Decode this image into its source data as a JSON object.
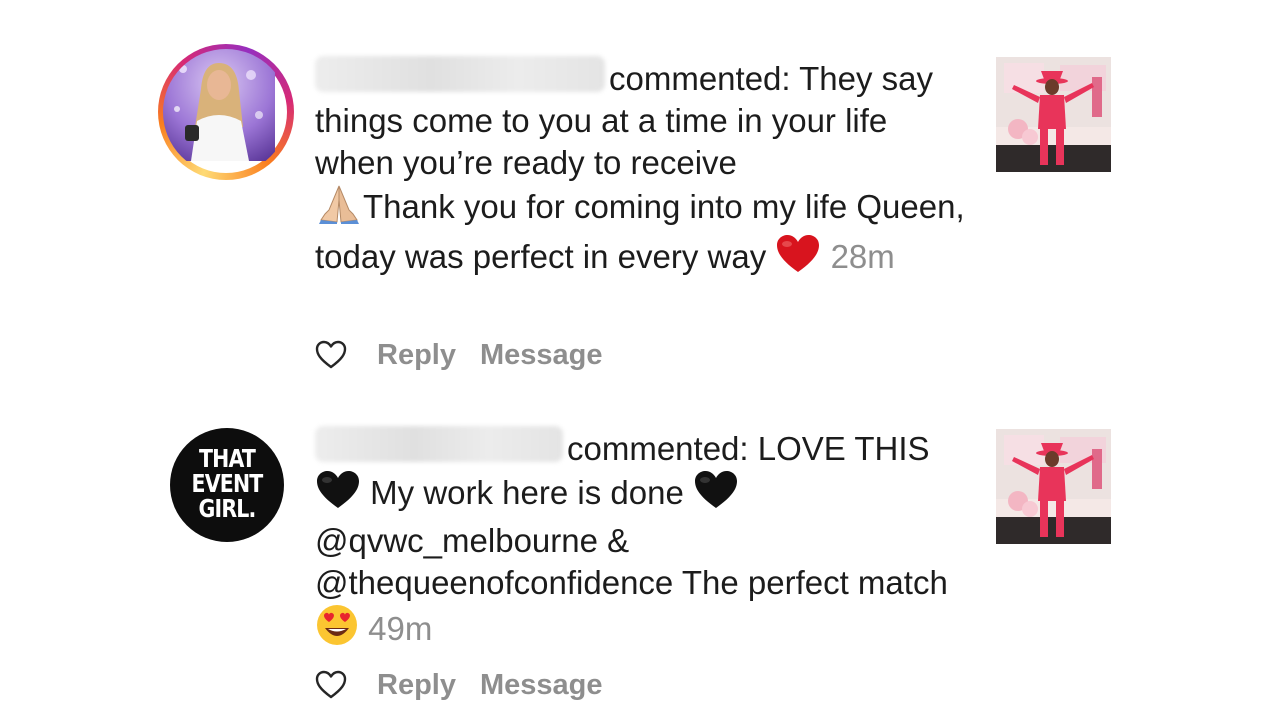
{
  "notifications": [
    {
      "type": "comment",
      "username": "",
      "comment_text": "commented: They say things come to you at a time in your life when you’re ready to receive",
      "comment_text_2": "Thank you for coming into my life Queen, today was perfect in every way",
      "emoji_1": "folded-hands-emoji",
      "emoji_2": "red-heart-emoji",
      "time": "28m",
      "reply_label": "Reply",
      "message_label": "Message",
      "avatar_style": "story-ring"
    },
    {
      "type": "comment",
      "username": "",
      "comment_text": "commented: LOVE THIS",
      "comment_text_2": "My work here is done",
      "comment_text_3": "@qvwc_melbourne & @thequeenofconfidence The perfect match",
      "emoji_1": "black-heart-emoji",
      "emoji_2": "black-heart-emoji",
      "emoji_3": "heart-eyes-emoji",
      "time": "49m",
      "reply_label": "Reply",
      "message_label": "Message",
      "logo_lines": [
        "THAT",
        "EVENT",
        "GIRL."
      ]
    }
  ],
  "colors": {
    "text": "#1c1c1c",
    "muted": "#8e8e8e",
    "ring_gradient": [
      "#feda75",
      "#fa7e1e",
      "#d62976",
      "#962fbf"
    ],
    "logo_bg": "#0d0d0d",
    "thumb_outfit": "#e8345a"
  }
}
